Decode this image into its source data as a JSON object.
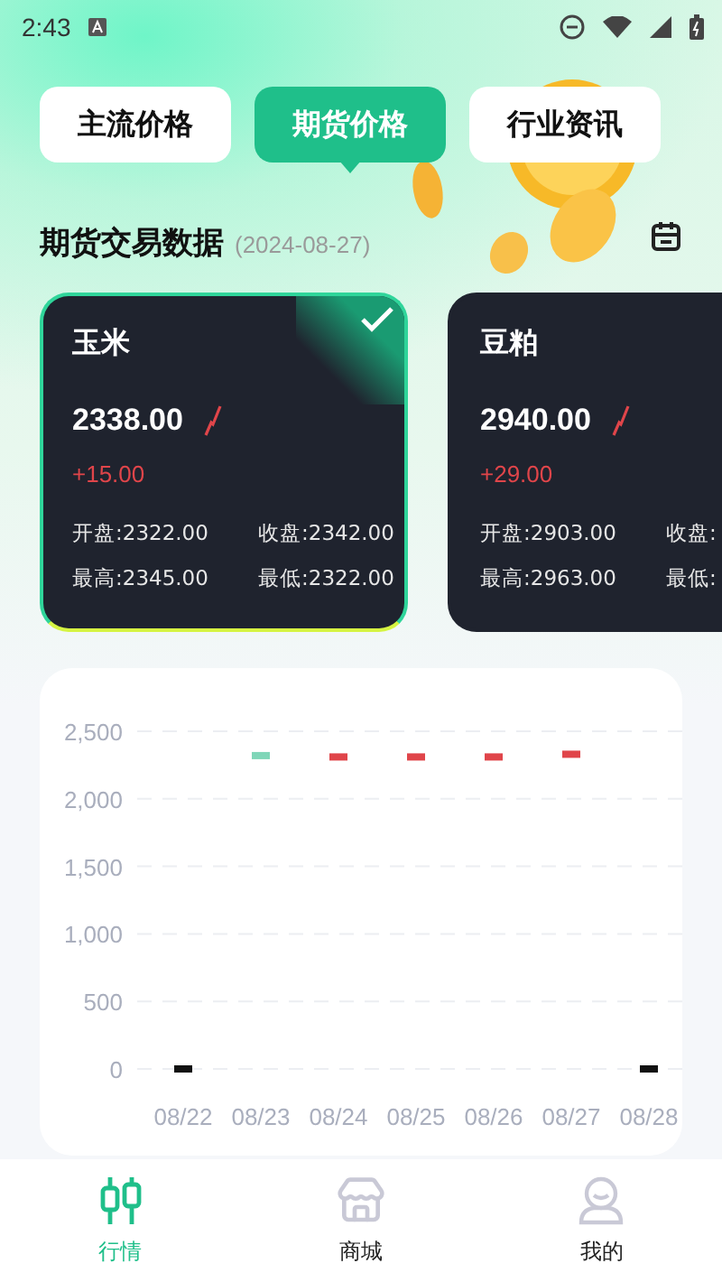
{
  "status_bar": {
    "time": "2:43"
  },
  "tabs": [
    {
      "label": "主流价格",
      "selected": false
    },
    {
      "label": "期货价格",
      "selected": true
    },
    {
      "label": "行业资讯",
      "selected": false
    }
  ],
  "section": {
    "title": "期货交易数据",
    "date": "(2024-08-27)"
  },
  "cards": [
    {
      "name": "玉米",
      "price": "2338.00",
      "change": "+15.00",
      "open": "开盘:2322.00",
      "close": "收盘:2342.00",
      "high": "最高:2345.00",
      "low": "最低:2322.00",
      "selected": true
    },
    {
      "name": "豆粕",
      "price": "2940.00",
      "change": "+29.00",
      "open": "开盘:2903.00",
      "close": "收盘:",
      "high": "最高:2963.00",
      "low": "最低:",
      "selected": false
    }
  ],
  "chart_data": {
    "type": "scatter",
    "categories": [
      "08/22",
      "08/23",
      "08/24",
      "08/25",
      "08/26",
      "08/27",
      "08/28"
    ],
    "grid": true,
    "series": [
      {
        "color": "#111111",
        "values": [
          0,
          null,
          null,
          null,
          null,
          null,
          0
        ]
      },
      {
        "color": "#7fd6b8",
        "values": [
          null,
          2320,
          null,
          null,
          null,
          null,
          null
        ]
      },
      {
        "color": "#e0454a",
        "values": [
          null,
          null,
          2310,
          2310,
          2310,
          2330,
          null
        ]
      }
    ],
    "ylim": [
      0,
      2500
    ],
    "yticks": [
      {
        "value": 0,
        "label": "0"
      },
      {
        "value": 500,
        "label": "500"
      },
      {
        "value": 1000,
        "label": "1,000"
      },
      {
        "value": 1500,
        "label": "1,500"
      },
      {
        "value": 2000,
        "label": "2,000"
      },
      {
        "value": 2500,
        "label": "2,500"
      }
    ]
  },
  "nav": [
    {
      "label": "行情",
      "kind": "market",
      "selected": true
    },
    {
      "label": "商城",
      "kind": "store",
      "selected": false
    },
    {
      "label": "我的",
      "kind": "profile",
      "selected": false
    }
  ]
}
